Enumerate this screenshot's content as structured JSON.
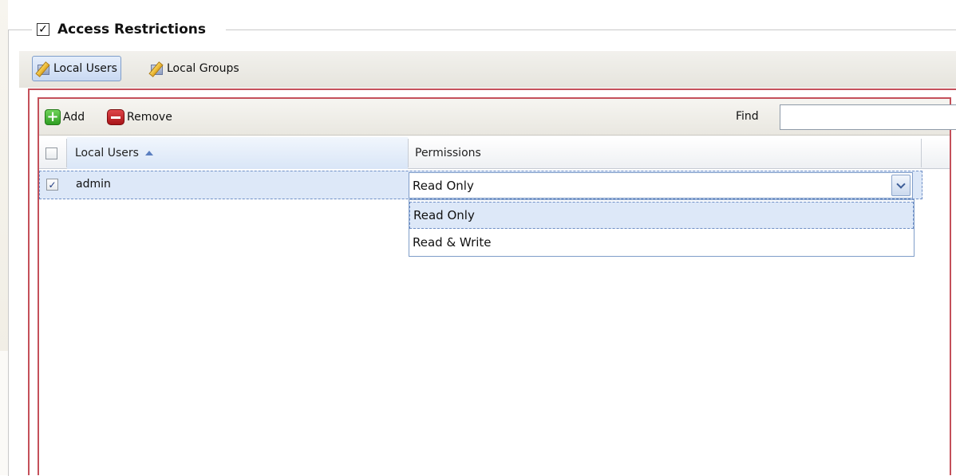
{
  "fieldset": {
    "title": "Access Restrictions",
    "checked_glyph": "✓"
  },
  "tabs": [
    {
      "label": "Local Users",
      "icon": "users-edit-icon",
      "active": true
    },
    {
      "label": "Local Groups",
      "icon": "groups-edit-icon",
      "active": false
    }
  ],
  "toolbar": {
    "add_label": "Add",
    "remove_label": "Remove",
    "find_label": "Find",
    "find_value": ""
  },
  "grid": {
    "columns": [
      {
        "label": "Local Users",
        "sorted": "ascending"
      },
      {
        "label": "Permissions"
      }
    ],
    "rows": [
      {
        "checked": true,
        "checked_glyph": "✓",
        "user": "admin",
        "permission": "Read Only"
      }
    ]
  },
  "dropdown": {
    "options": [
      "Read Only",
      "Read & Write"
    ],
    "selected": "Read Only"
  },
  "colors": {
    "frame_red": "#c4505a",
    "selection_blue": "#dde8f8",
    "add_green": "#2f9e22",
    "remove_red": "#a81418"
  }
}
